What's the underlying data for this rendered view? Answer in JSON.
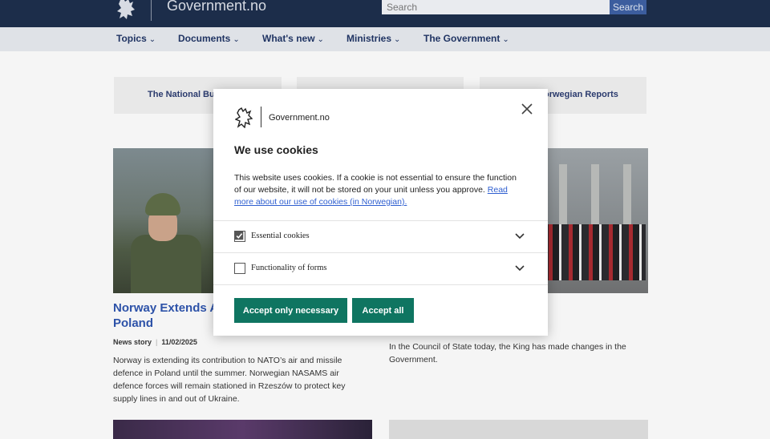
{
  "header": {
    "site_title": "Government.no",
    "search_placeholder": "Search",
    "search_button": "Search"
  },
  "nav": {
    "items": [
      {
        "label": "Topics"
      },
      {
        "label": "Documents"
      },
      {
        "label": "What's new"
      },
      {
        "label": "Ministries"
      },
      {
        "label": "The Government"
      }
    ]
  },
  "top_cards": [
    {
      "label": "The National Bu"
    },
    {
      "label": ""
    },
    {
      "label": "orwegian Reports"
    }
  ],
  "articles": {
    "left": {
      "title": "Norway Extends A… Poland",
      "title_line1": "Norway Extends A",
      "title_line2": "Poland",
      "type": "News story",
      "date": "11/02/2025",
      "ingress": "Norway is extending its contribution to NATO’s air and missile defence in Poland until the summer. Norwegian NASAMS air defence forces will remain stationed in Rzeszów to protect key supply lines in and out of Ukraine."
    },
    "right": {
      "ingress": "In the Council of State today, the King has made changes in the Government."
    }
  },
  "cookie_dialog": {
    "brand": "Government.no",
    "heading": "We use cookies",
    "body": "This website uses cookies. If a cookie is not essential to ensure the function of our website, it will not be stored on your unit unless you approve.",
    "link_text": "Read more about our use of cookies (in Norwegian).",
    "options": [
      {
        "label": "Essential cookies",
        "checked": true
      },
      {
        "label": "Functionality of forms",
        "checked": false
      }
    ],
    "accept_necessary": "Accept only necessary",
    "accept_all": "Accept all"
  },
  "colors": {
    "header_bg": "#1c2d4a",
    "nav_text": "#203463",
    "link_blue": "#2d52a8",
    "button_green": "#0f7561"
  },
  "icons": [
    "lion-logo-icon",
    "close-icon",
    "chevron-down-icon",
    "checkmark-icon"
  ]
}
